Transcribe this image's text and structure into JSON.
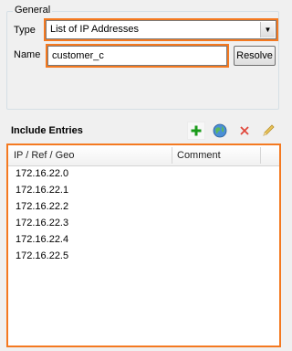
{
  "general": {
    "title": "General",
    "type_label": "Type",
    "type_value": "List of IP Addresses",
    "name_label": "Name",
    "name_value": "customer_c",
    "resolve_label": "Resolve"
  },
  "include": {
    "title": "Include Entries",
    "toolbar": {
      "add_icon": "plus-icon",
      "globe_icon": "globe-icon",
      "remove_icon": "x-icon",
      "edit_icon": "pencil-icon"
    },
    "columns": [
      "IP / Ref / Geo",
      "Comment"
    ],
    "rows": [
      "172.16.22.0",
      "172.16.22.1",
      "172.16.22.2",
      "172.16.22.3",
      "172.16.22.4",
      "172.16.22.5"
    ]
  },
  "colors": {
    "highlight": "#f47920",
    "add_green": "#1a9b1a",
    "remove_red": "#e0463a"
  }
}
